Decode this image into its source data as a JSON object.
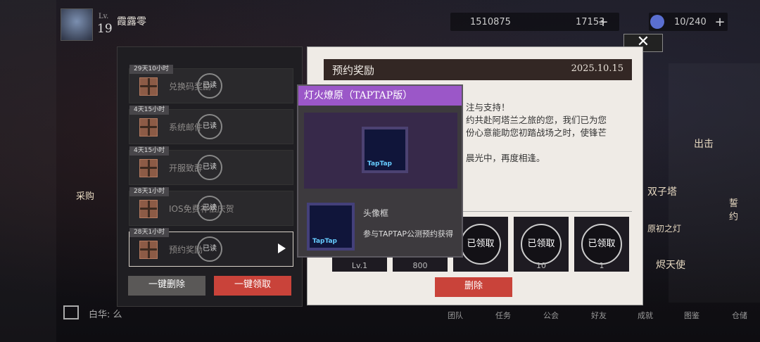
{
  "player": {
    "level_label": "Lv.",
    "level": "19",
    "name": "霞露零"
  },
  "resources": [
    {
      "value": "1510875",
      "plus": "+"
    },
    {
      "value": "17153",
      "plus": "+"
    },
    {
      "value": "10/240",
      "plus": "+"
    }
  ],
  "mail_list": [
    {
      "time": "29天10小时",
      "title": "兑换码奖励",
      "status": "已读"
    },
    {
      "time": "4天15小时",
      "title": "系统邮件",
      "status": "已读"
    },
    {
      "time": "4天15小时",
      "title": "开服致辞",
      "status": "已读"
    },
    {
      "time": "28天1小时",
      "title": "IOS免费补偿庆贺",
      "status": "已读"
    },
    {
      "time": "28天1小时",
      "title": "预约奖励",
      "status": "已读"
    }
  ],
  "left_buttons": {
    "delete_all": "一键删除",
    "claim_all": "一键领取"
  },
  "detail": {
    "title": "预约奖励",
    "date": "2025.10.15",
    "lines": [
      "注与支持！",
      "约共赴阿塔兰之旅的您，我们已为您",
      "份心意能助您初踏战场之时，使锋芒",
      "",
      "晨光中，再度相逢。"
    ],
    "delete_label": "删除"
  },
  "rewards": [
    {
      "count": "Lv.1",
      "claimed": ""
    },
    {
      "count": "800",
      "claimed": ""
    },
    {
      "count": "",
      "claimed": "已领取"
    },
    {
      "count": "10",
      "claimed": "已领取"
    },
    {
      "count": "1",
      "claimed": "已领取"
    }
  ],
  "popup": {
    "title": "灯火燎原（TAPTAP版）",
    "item_name": "头像框",
    "item_desc": "参与TAPTAP公测预约获得",
    "taptap_label": "TapTap"
  },
  "close_label": "✕",
  "side_labels": [
    "出击",
    "双子塔",
    "原初之灯",
    "烬天使",
    "誓约"
  ],
  "chat": {
    "text": "白华: 么"
  },
  "bottom_nav": [
    "团队",
    "任务",
    "公会",
    "好友",
    "成就",
    "图鉴",
    "仓储"
  ],
  "left_side": {
    "collect": "采购"
  }
}
